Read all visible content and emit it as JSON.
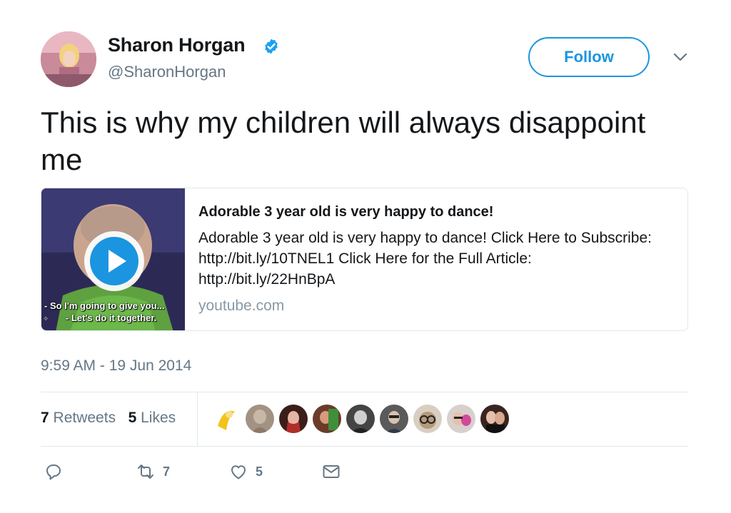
{
  "user": {
    "name": "Sharon Horgan",
    "handle": "@SharonHorgan",
    "follow_label": "Follow"
  },
  "tweet": {
    "text": "This is why my children will always disappoint me",
    "timestamp": "9:59 AM - 19 Jun 2014"
  },
  "media": {
    "title": "Adorable 3 year old is very happy to dance!",
    "description": "Adorable 3 year old is very happy to dance! Click Here to Subscribe: http://bit.ly/10TNEL1 Click Here for the Full Article: http://bit.ly/22HnBpA",
    "domain": "youtube.com",
    "subtitle_line1": "- So I'm going to give you...",
    "subtitle_line2": "- Let's do it together."
  },
  "stats": {
    "retweets_count": "7",
    "retweets_label": "Retweets",
    "likes_count": "5",
    "likes_label": "Likes"
  },
  "actions": {
    "retweet_count": "7",
    "like_count": "5"
  },
  "colors": {
    "accent": "#1b95e0",
    "secondary_text": "#657786",
    "border": "#e1e8ed"
  }
}
